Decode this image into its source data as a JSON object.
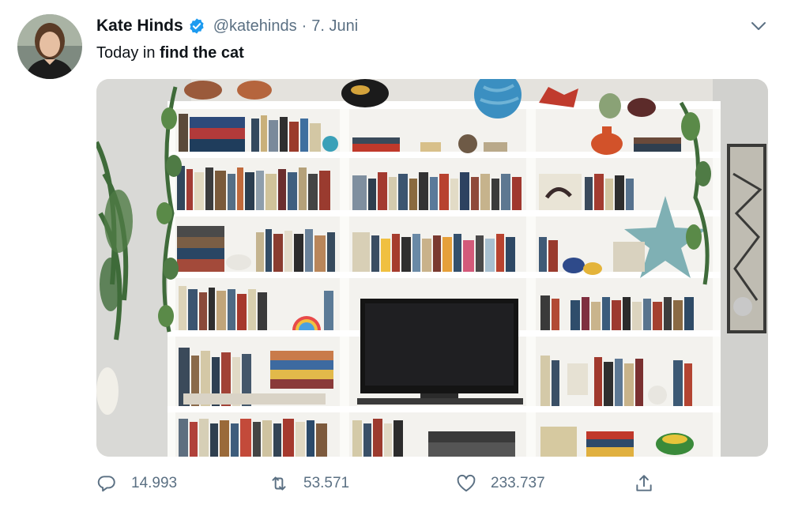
{
  "tweet": {
    "author": {
      "display_name": "Kate Hinds",
      "handle": "@katehinds",
      "verified": true,
      "avatar_icon": "profile-photo"
    },
    "separator": "·",
    "date": "7. Juni",
    "text": {
      "prefix": "Today in ",
      "emphasis": "find the cat"
    },
    "media": {
      "kind": "photo",
      "subject": "white bookshelf with books, plants, globe, star and TV"
    },
    "actions": {
      "reply": {
        "icon": "reply-icon",
        "count": "14.993"
      },
      "retweet": {
        "icon": "retweet-icon",
        "count": "53.571"
      },
      "like": {
        "icon": "heart-icon",
        "count": "233.737"
      },
      "share": {
        "icon": "share-icon"
      }
    },
    "menu_icon": "chevron-down-icon"
  },
  "colors": {
    "text_primary": "#0f1419",
    "text_secondary": "#5b7083",
    "verified_blue": "#1d9bf0"
  }
}
